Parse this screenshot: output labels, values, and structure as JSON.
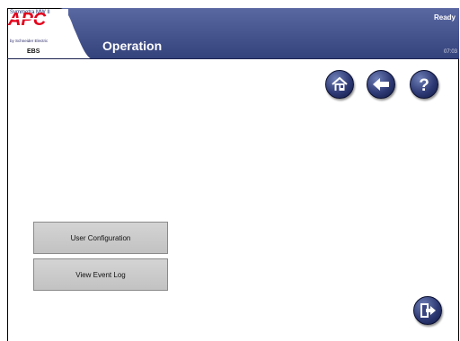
{
  "header": {
    "product_name": "Symmetra MW II",
    "brand": "APC",
    "brand_sub": "by Schneider Electric",
    "unit": "EBS",
    "title": "Operation",
    "status": "Ready",
    "time": "07:03"
  },
  "nav": {
    "home_icon": "home-icon",
    "back_icon": "back-arrow-icon",
    "help_icon": "help-icon",
    "logout_icon": "logout-door-icon"
  },
  "menu": {
    "user_configuration": "User Configuration",
    "view_event_log": "View Event Log"
  },
  "colors": {
    "header_blue": "#3d4c86",
    "brand_red": "#e3001b",
    "button_gray": "#c8c8c8"
  }
}
